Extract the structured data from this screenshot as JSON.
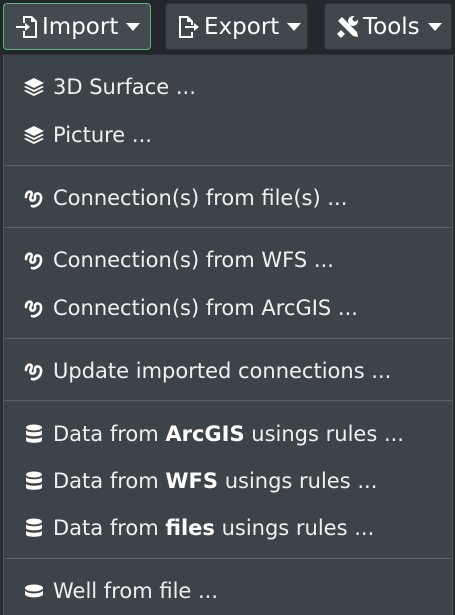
{
  "toolbar": {
    "import_label": "Import",
    "export_label": "Export",
    "tools_label": "Tools"
  },
  "menu": {
    "items": [
      {
        "label": "3D Surface ...",
        "icon": "layers-icon"
      },
      {
        "label": "Picture ...",
        "icon": "layers-icon"
      },
      {
        "label": "Connection(s) from file(s) ...",
        "icon": "connection-icon"
      },
      {
        "label": "Connection(s) from WFS ...",
        "icon": "connection-icon"
      },
      {
        "label": "Connection(s) from ArcGIS ...",
        "icon": "connection-icon"
      },
      {
        "label": "Update imported connections ...",
        "icon": "connection-icon"
      },
      {
        "pre": "Data from ",
        "bold": "ArcGIS",
        "post": " usings rules ...",
        "icon": "database-icon"
      },
      {
        "pre": "Data from ",
        "bold": "WFS",
        "post": " usings rules ...",
        "icon": "database-icon"
      },
      {
        "pre": "Data from ",
        "bold": "files",
        "post": " usings rules ...",
        "icon": "database-icon"
      },
      {
        "label": "Well from file ...",
        "icon": "well-icon"
      }
    ]
  },
  "colors": {
    "menu_bg": "#3d4449",
    "button_bg": "#3f474d",
    "active_border": "#5fb37f",
    "text": "#f0f0f0"
  }
}
